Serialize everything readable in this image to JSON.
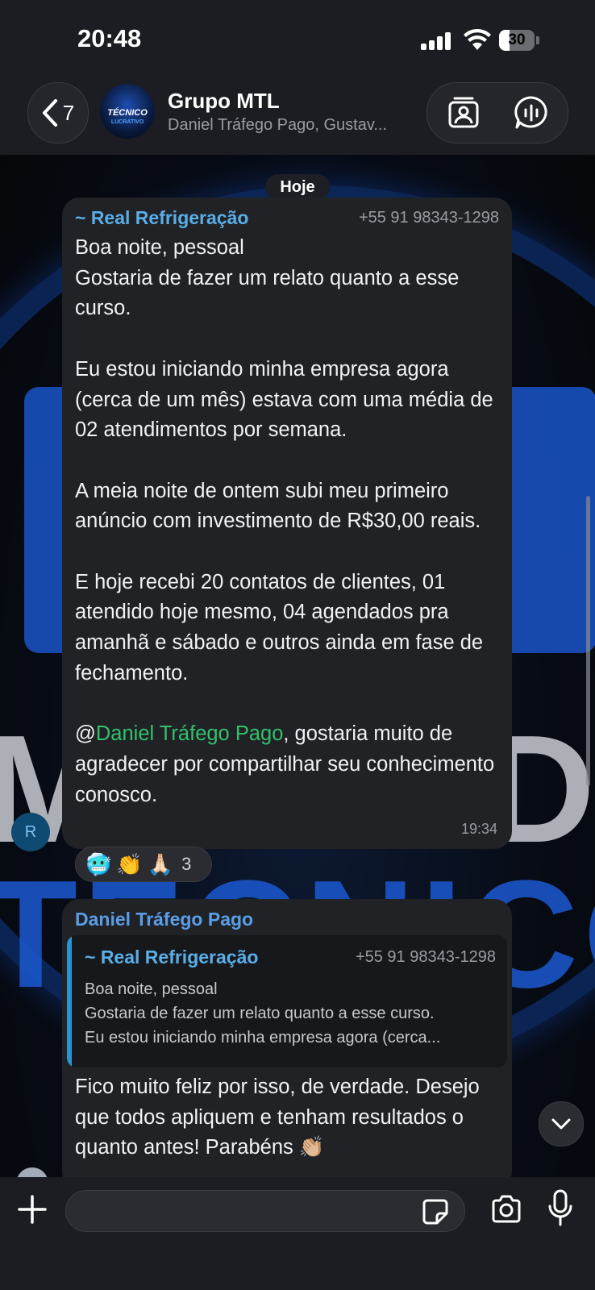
{
  "status_bar": {
    "time": "20:48",
    "battery_level": "30",
    "battery_fraction": 0.3
  },
  "header": {
    "back_count": "7",
    "group_name": "Grupo MTL",
    "members_preview": "Daniel Tráfego Pago, Gustav...",
    "avatar_text": "TÉCNICO",
    "avatar_subtext": "LUCRATIVO"
  },
  "date_chip": "Hoje",
  "messages": [
    {
      "sender": "~ Real Refrigeração",
      "phone": "+55 91 98343-1298",
      "body_before_mention": "Boa noite, pessoal\nGostaria de fazer um relato quanto a esse curso.\n\nEu estou iniciando minha empresa agora (cerca de um mês) estava com uma média de 02 atendimentos por semana.\n\nA meia noite de ontem subi meu primeiro anúncio com investimento de R$30,00 reais.\n\nE hoje recebi 20 contatos de clientes, 01 atendido hoje mesmo, 04 agendados pra amanhã e sábado e outros ainda em fase de fechamento.\n\n@",
      "mention": "Daniel Tráfego Pago",
      "body_after_mention": ", gostaria muito de agradecer por compartilhar seu conhecimento conosco.",
      "time": "19:34",
      "avatar_initial": "R",
      "reactions": {
        "emoji_1": "🥶",
        "emoji_2": "👏",
        "emoji_3": "🙏🏻",
        "count": "3"
      }
    },
    {
      "sender": "Daniel Tráfego Pago",
      "quote": {
        "sender": "~ Real Refrigeração",
        "phone": "+55 91 98343-1298",
        "line_1": "Boa noite, pessoal",
        "line_2": "Gostaria de fazer um relato quanto a esse curso.",
        "line_3": "Eu estou iniciando minha empresa agora (cerca..."
      },
      "body": "Fico muito feliz por isso, de verdade. Desejo que todos apliquem e tenham resultados o quanto antes! Parabéns 👏🏼"
    }
  ],
  "composer": {
    "placeholder": ""
  },
  "colors": {
    "bubble": "#202226",
    "sender_link": "#5aaee8",
    "mention": "#33c16a",
    "bar": "#1b1d22"
  }
}
